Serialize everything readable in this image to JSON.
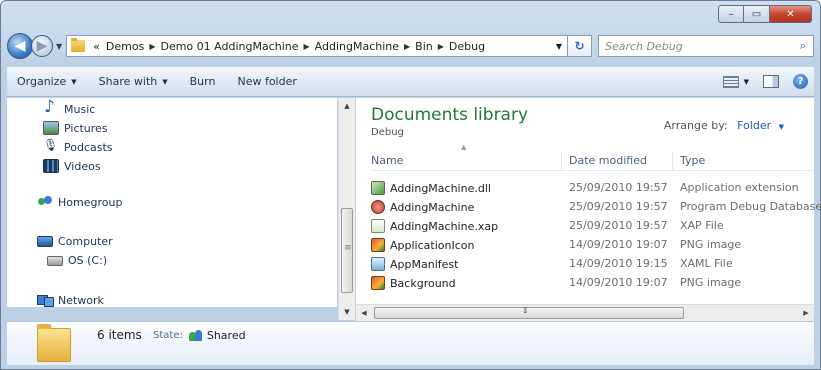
{
  "window": {
    "caption": {
      "min": "–",
      "max": "▭",
      "close": "✕"
    }
  },
  "nav": {
    "back": "◀",
    "forward": "▶",
    "dropdown": "▼",
    "address": {
      "lead": "«",
      "crumbs": [
        "Demos",
        "Demo 01 AddingMachine",
        "AddingMachine",
        "Bin",
        "Debug"
      ],
      "separator": "▶",
      "dropdown": "▼"
    },
    "refresh": "↻",
    "search": {
      "placeholder": "Search Debug",
      "icon": "⌕"
    }
  },
  "commandbar": {
    "organize": "Organize",
    "share_with": "Share with",
    "burn": "Burn",
    "new_folder": "New folder",
    "arrow": "▼",
    "help": "?"
  },
  "navpane": {
    "items": [
      {
        "label": "Music",
        "icon": "music-icon"
      },
      {
        "label": "Pictures",
        "icon": "pictures-icon"
      },
      {
        "label": "Podcasts",
        "icon": "podcasts-icon"
      },
      {
        "label": "Videos",
        "icon": "videos-icon"
      },
      {
        "label": "Homegroup",
        "icon": "homegroup-icon"
      },
      {
        "label": "Computer",
        "icon": "computer-icon"
      },
      {
        "label": "OS (C:)",
        "icon": "drive-icon"
      },
      {
        "label": "Network",
        "icon": "network-icon"
      }
    ],
    "scroll_up": "▲",
    "scroll_down": "▼"
  },
  "content": {
    "library_title": "Documents library",
    "library_subtitle": "Debug",
    "arrange_label": "Arrange by:",
    "arrange_value": "Folder",
    "arrange_arrow": "▼",
    "columns": {
      "name": "Name",
      "date": "Date modified",
      "type": "Type"
    },
    "sort_caret": "▲",
    "files": [
      {
        "name": "AddingMachine.dll",
        "date": "25/09/2010 19:57",
        "type": "Application extension",
        "icon": "dll-file-icon"
      },
      {
        "name": "AddingMachine",
        "date": "25/09/2010 19:57",
        "type": "Program Debug Database",
        "icon": "pdb-file-icon"
      },
      {
        "name": "AddingMachine.xap",
        "date": "25/09/2010 19:57",
        "type": "XAP File",
        "icon": "xap-file-icon"
      },
      {
        "name": "ApplicationIcon",
        "date": "14/09/2010 19:07",
        "type": "PNG image",
        "icon": "png-file-icon"
      },
      {
        "name": "AppManifest",
        "date": "14/09/2010 19:15",
        "type": "XAML File",
        "icon": "xaml-file-icon"
      },
      {
        "name": "Background",
        "date": "14/09/2010 19:07",
        "type": "PNG image",
        "icon": "png-file-icon"
      }
    ],
    "hscroll_left": "◀",
    "hscroll_right": "▶"
  },
  "details": {
    "count": "6 items",
    "state_label": "State:",
    "state_value": "Shared"
  },
  "colors": {
    "library_title": "#1f7a3a",
    "link_blue": "#1c5fb5",
    "close_red": "#c74533"
  }
}
